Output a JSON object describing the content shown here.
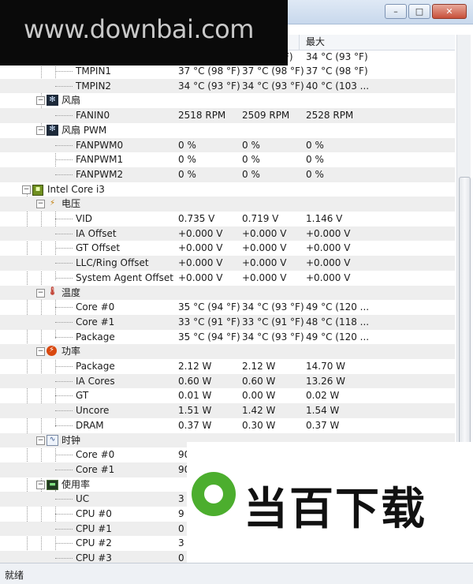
{
  "window": {
    "min_label": "–",
    "max_label": "□",
    "close_label": "✕"
  },
  "header": {
    "col_max": "最大"
  },
  "status_bar": {
    "text": "就绪"
  },
  "watermark_top": "www.downbai.com",
  "watermark_bottom": "当百下载",
  "rows": {
    "tmpin1": {
      "label": "TMPIN1",
      "v1": "37 °C  (98 °F)",
      "v2": "37 °C  (98 °F)",
      "v3": "37 °C  (98 °F)"
    },
    "tmpin2": {
      "label": "TMPIN2",
      "v1": "34 °C  (93 °F)",
      "v2": "34 °C  (93 °F)",
      "v3": "40 °C  (103 ..."
    },
    "fan_cat": {
      "label": "风扇"
    },
    "fanin0": {
      "label": "FANIN0",
      "v1": "2518 RPM",
      "v2": "2509 RPM",
      "v3": "2528 RPM"
    },
    "fanpwm_cat": {
      "label": "风扇 PWM"
    },
    "fanpwm0": {
      "label": "FANPWM0",
      "v1": "0 %",
      "v2": "0 %",
      "v3": "0 %"
    },
    "fanpwm1": {
      "label": "FANPWM1",
      "v1": "0 %",
      "v2": "0 %",
      "v3": "0 %"
    },
    "fanpwm2": {
      "label": "FANPWM2",
      "v1": "0 %",
      "v2": "0 %",
      "v3": "0 %"
    },
    "cpu_dev": {
      "label": "Intel Core i3"
    },
    "volt_cat": {
      "label": "电压"
    },
    "vid": {
      "label": "VID",
      "v1": "0.735 V",
      "v2": "0.719 V",
      "v3": "1.146 V"
    },
    "ia_offset": {
      "label": "IA Offset",
      "v1": "+0.000 V",
      "v2": "+0.000 V",
      "v3": "+0.000 V"
    },
    "gt_offset": {
      "label": "GT Offset",
      "v1": "+0.000 V",
      "v2": "+0.000 V",
      "v3": "+0.000 V"
    },
    "llc_offset": {
      "label": "LLC/Ring Offset",
      "v1": "+0.000 V",
      "v2": "+0.000 V",
      "v3": "+0.000 V"
    },
    "sa_offset": {
      "label": "System Agent Offset",
      "v1": "+0.000 V",
      "v2": "+0.000 V",
      "v3": "+0.000 V"
    },
    "temp_cat": {
      "label": "温度"
    },
    "core0_t": {
      "label": "Core #0",
      "v1": "35 °C  (94 °F)",
      "v2": "34 °C  (93 °F)",
      "v3": "49 °C  (120 ..."
    },
    "core1_t": {
      "label": "Core #1",
      "v1": "33 °C  (91 °F)",
      "v2": "33 °C  (91 °F)",
      "v3": "48 °C  (118 ..."
    },
    "package_t": {
      "label": "Package",
      "v1": "35 °C  (94 °F)",
      "v2": "34 °C  (93 °F)",
      "v3": "49 °C  (120 ..."
    },
    "power_cat": {
      "label": "功率"
    },
    "package_p": {
      "label": "Package",
      "v1": "2.12 W",
      "v2": "2.12 W",
      "v3": "14.70 W"
    },
    "ia_cores": {
      "label": "IA Cores",
      "v1": "0.60 W",
      "v2": "0.60 W",
      "v3": "13.26 W"
    },
    "gt_p": {
      "label": "GT",
      "v1": "0.01 W",
      "v2": "0.00 W",
      "v3": "0.02 W"
    },
    "uncore": {
      "label": "Uncore",
      "v1": "1.51 W",
      "v2": "1.42 W",
      "v3": "1.54 W"
    },
    "dram": {
      "label": "DRAM",
      "v1": "0.37 W",
      "v2": "0.30 W",
      "v3": "0.37 W"
    },
    "clock_cat": {
      "label": "时钟"
    },
    "core0_c": {
      "label": "Core #0",
      "v1": "90"
    },
    "core1_c": {
      "label": "Core #1",
      "v1": "90"
    },
    "util_cat": {
      "label": "使用率"
    },
    "uc": {
      "label": "UC",
      "v1": "3"
    },
    "cpu0": {
      "label": "CPU #0",
      "v1": "9"
    },
    "cpu1": {
      "label": "CPU #1",
      "v1": "0"
    },
    "cpu2": {
      "label": "CPU #2",
      "v1": "3"
    },
    "cpu3": {
      "label": "CPU #3",
      "v1": "0 %"
    }
  },
  "top_partial": {
    "v2_tail": "F)",
    "v3": "34 °C  (93 °F)"
  }
}
